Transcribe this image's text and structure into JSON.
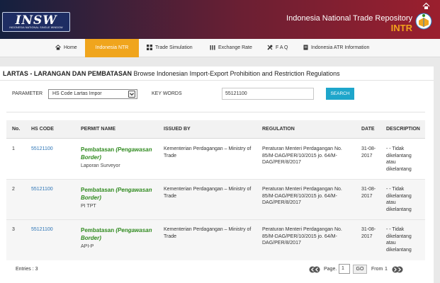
{
  "header": {
    "logo_text": "INSW",
    "logo_subtitle": "INDONESIA NATIONAL SINGLE WINDOW",
    "title": "Indonesia National Trade Repository",
    "acronym": "INTR"
  },
  "nav": {
    "items": [
      {
        "label": "Home",
        "icon": "home-icon"
      },
      {
        "label": "Indonesia NTR",
        "icon": "none"
      },
      {
        "label": "Trade Simulation",
        "icon": "grid-icon"
      },
      {
        "label": "Exchange Rate",
        "icon": "bars-icon"
      },
      {
        "label": "F A Q",
        "icon": "wrench-icon"
      },
      {
        "label": "Indonesia ATR Information",
        "icon": "document-icon"
      }
    ],
    "active_index": 1
  },
  "page": {
    "title_bold": "LARTAS - LARANGAN DAN PEMBATASAN",
    "title_rest": "Browse Indonesian Import-Export Prohibition and Restriction Regulations"
  },
  "search": {
    "parameter_label": "PARAMETER",
    "parameter_value": "HS Code Lartas Impor",
    "keywords_label": "KEY WORDS",
    "keywords_value": "55121100",
    "button_label": "SEARCH"
  },
  "table": {
    "columns": [
      "No.",
      "HS CODE",
      "PERMIT NAME",
      "ISSUED BY",
      "REGULATION",
      "DATE",
      "DESCRIPTION"
    ],
    "rows": [
      {
        "no": "1",
        "hs_code": "55121100",
        "permit_main": "Pembatasan",
        "permit_note": "(Pengawasan Border)",
        "permit_sub": "Laporan Surveyor",
        "issued_by": "Kementerian Perdagangan – Ministry of Trade",
        "regulation": "Peraturan Menteri Perdagangan No. 85/M-DAG/PER/10/2015 jo. 64/M-DAG/PER/8/2017",
        "date": "31-08-2017",
        "description": "- - Tidak dikelantang atau dikelantang"
      },
      {
        "no": "2",
        "hs_code": "55121100",
        "permit_main": "Pembatasan",
        "permit_note": "(Pengawasan Border)",
        "permit_sub": "PI TPT",
        "issued_by": "Kementerian Perdagangan – Ministry of Trade",
        "regulation": "Peraturan Menteri Perdagangan No. 85/M-DAG/PER/10/2015 jo. 64/M-DAG/PER/8/2017",
        "date": "31-08-2017",
        "description": "- - Tidak dikelantang atau dikelantang"
      },
      {
        "no": "3",
        "hs_code": "55121100",
        "permit_main": "Pembatasan",
        "permit_note": "(Pengawasan Border)",
        "permit_sub": "API-P",
        "issued_by": "Kementerian Perdagangan – Ministry of Trade",
        "regulation": "Peraturan Menteri Perdagangan No. 85/M-DAG/PER/10/2015 jo. 64/M-DAG/PER/8/2017",
        "date": "31-08-2017",
        "description": "- - Tidak dikelantang atau dikelantang"
      }
    ]
  },
  "footer": {
    "entries_label": "Entries : 3",
    "page_label": "Page.",
    "page_value": "1",
    "go_label": "GO",
    "from_label": "From",
    "total_pages": "1"
  },
  "colors": {
    "accent": "#f0a51d",
    "link": "#2a73b5",
    "permit": "#2f8a1e",
    "button": "#1ea6cb"
  }
}
